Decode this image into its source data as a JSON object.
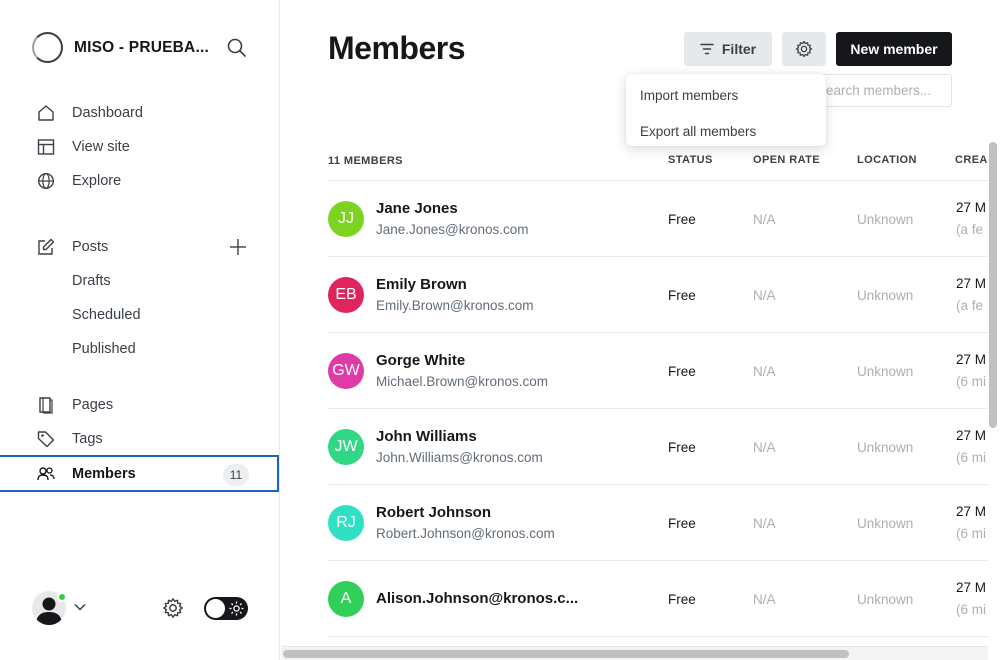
{
  "sidebar": {
    "site_name": "MISO - PRUEBA...",
    "nav": [
      {
        "label": "Dashboard"
      },
      {
        "label": "View site"
      },
      {
        "label": "Explore"
      },
      {
        "label": "Posts"
      },
      {
        "label": "Drafts"
      },
      {
        "label": "Scheduled"
      },
      {
        "label": "Published"
      },
      {
        "label": "Pages"
      },
      {
        "label": "Tags"
      },
      {
        "label": "Members",
        "count": "11"
      }
    ]
  },
  "header": {
    "title": "Members",
    "filter_label": "Filter",
    "new_member_label": "New member",
    "search_placeholder": "Search members..."
  },
  "dropdown": {
    "items": [
      "Import members",
      "Export all members"
    ]
  },
  "table": {
    "count_label": "11 MEMBERS",
    "columns": [
      "STATUS",
      "OPEN RATE",
      "LOCATION",
      "CREA"
    ],
    "rows": [
      {
        "initials": "JJ",
        "color": "#7ed321",
        "name": "Jane Jones",
        "email": "Jane.Jones@kronos.com",
        "status": "Free",
        "open_rate": "N/A",
        "location": "Unknown",
        "created": "27 M",
        "created_rel": "(a fe"
      },
      {
        "initials": "EB",
        "color": "#e0245e",
        "name": "Emily Brown",
        "email": "Emily.Brown@kronos.com",
        "status": "Free",
        "open_rate": "N/A",
        "location": "Unknown",
        "created": "27 M",
        "created_rel": "(a fe"
      },
      {
        "initials": "GW",
        "color": "#e03aa8",
        "name": "Gorge White",
        "email": "Michael.Brown@kronos.com",
        "status": "Free",
        "open_rate": "N/A",
        "location": "Unknown",
        "created": "27 M",
        "created_rel": "(6 mi"
      },
      {
        "initials": "JW",
        "color": "#30d886",
        "name": "John Williams",
        "email": "John.Williams@kronos.com",
        "status": "Free",
        "open_rate": "N/A",
        "location": "Unknown",
        "created": "27 M",
        "created_rel": "(6 mi"
      },
      {
        "initials": "RJ",
        "color": "#2ee0c4",
        "name": "Robert Johnson",
        "email": "Robert.Johnson@kronos.com",
        "status": "Free",
        "open_rate": "N/A",
        "location": "Unknown",
        "created": "27 M",
        "created_rel": "(6 mi"
      },
      {
        "initials": "A",
        "color": "#30cf5a",
        "name": "Alison.Johnson@kronos.c...",
        "email": "",
        "status": "Free",
        "open_rate": "N/A",
        "location": "Unknown",
        "created": "27 M",
        "created_rel": "(6 mi"
      }
    ]
  },
  "colors": {
    "accent": "#1b63c4",
    "online": "#30cf43",
    "primary_button": "#15171a"
  }
}
